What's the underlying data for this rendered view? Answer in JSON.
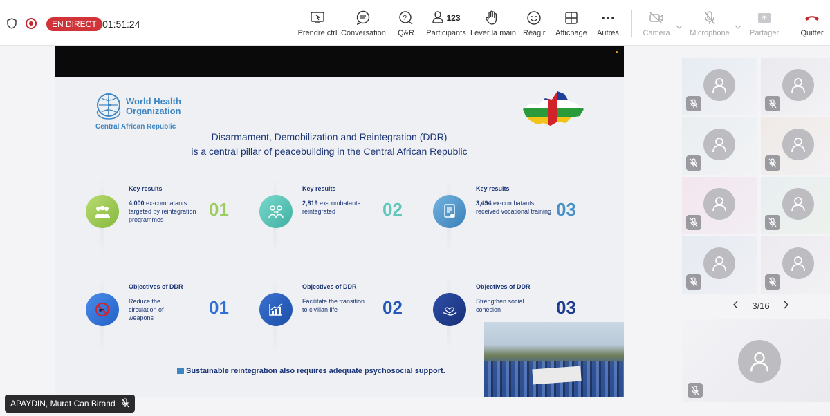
{
  "topbar": {
    "live_label": "EN DIRECT",
    "timer": "01:51:24",
    "tools": [
      {
        "label": "Prendre ctrl",
        "icon": "screen-share-icon"
      },
      {
        "label": "Conversation",
        "icon": "chat-icon"
      },
      {
        "label": "Q&R",
        "icon": "qa-icon"
      },
      {
        "label": "Participants",
        "icon": "people-icon",
        "count": "123"
      },
      {
        "label": "Lever la main",
        "icon": "hand-icon"
      },
      {
        "label": "Réagir",
        "icon": "smiley-icon"
      },
      {
        "label": "Affichage",
        "icon": "grid-icon"
      },
      {
        "label": "Autres",
        "icon": "more-icon"
      }
    ],
    "devices": [
      {
        "label": "Caméra",
        "icon": "camera-off-icon"
      },
      {
        "label": "Microphone",
        "icon": "mic-off-icon"
      },
      {
        "label": "Partager",
        "icon": "share-icon"
      }
    ],
    "leave_label": "Quitter"
  },
  "slide": {
    "org_name": "World Health Organization",
    "org_sub": "Central African Republic",
    "title_line1": "Disarmament, Demobilization and Reintegration (DDR)",
    "title_line2": "is a central pillar of peacebuilding in the Central African Republic",
    "key_results": [
      {
        "heading": "Key results",
        "value": "4,000",
        "text": "ex-combatants targeted by reintegration programmes",
        "num": "01",
        "color": "#9ccc5a"
      },
      {
        "heading": "Key results",
        "value": "2,819",
        "text": "ex-combatants reintegrated",
        "num": "02",
        "color": "#5ec8bb"
      },
      {
        "heading": "Key results",
        "value": "3,494",
        "text": "ex-combatants received vocational training",
        "num": "03",
        "color": "#4a90c8"
      }
    ],
    "objectives": [
      {
        "heading": "Objectives of DDR",
        "text": "Reduce the circulation of weapons",
        "num": "01",
        "color": "#2f6fd6"
      },
      {
        "heading": "Objectives of DDR",
        "text": "Facilitate the transition to civilian life",
        "num": "02",
        "color": "#2358b8"
      },
      {
        "heading": "Objectives of DDR",
        "text": "Strengthen social cohesion",
        "num": "03",
        "color": "#1d3b8f"
      }
    ],
    "footnote": "Sustainable reintegration also requires adequate psychosocial support."
  },
  "presenter": {
    "name": "APAYDIN, Murat Can Birand"
  },
  "gallery": {
    "page": "3/16"
  }
}
